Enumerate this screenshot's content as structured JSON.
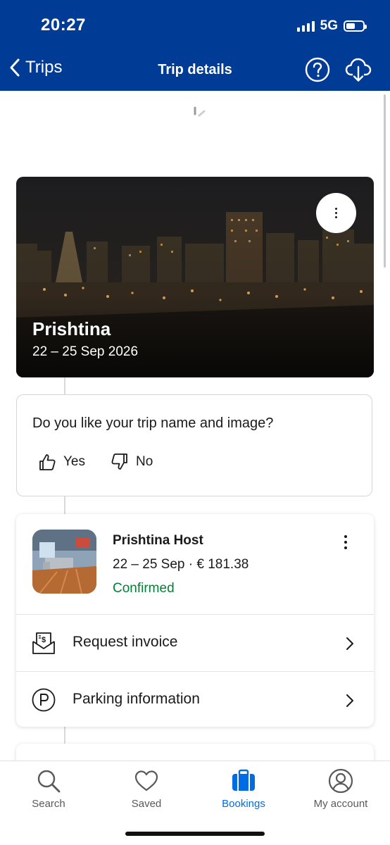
{
  "status_bar": {
    "time": "20:27",
    "network": "5G",
    "battery_level": 0.55
  },
  "header": {
    "back_label": "Trips",
    "title": "Trip details",
    "help_icon": "question-circle-icon",
    "download_icon": "cloud-download-icon"
  },
  "trip": {
    "name": "Prishtina",
    "dates": "22 – 25 Sep 2026"
  },
  "feedback": {
    "question": "Do you like your trip name and image?",
    "yes_label": "Yes",
    "no_label": "No"
  },
  "booking": {
    "name": "Prishtina Host",
    "details": "22 – 25 Sep · € 181.38",
    "status": "Confirmed",
    "actions": [
      {
        "label": "Request invoice",
        "icon": "invoice-icon"
      },
      {
        "label": "Parking information",
        "icon": "parking-icon"
      }
    ]
  },
  "nav": {
    "items": [
      {
        "label": "Search",
        "icon": "search-icon"
      },
      {
        "label": "Saved",
        "icon": "heart-icon"
      },
      {
        "label": "Bookings",
        "icon": "suitcase-icon",
        "active": true
      },
      {
        "label": "My account",
        "icon": "account-icon"
      }
    ]
  },
  "colors": {
    "brand": "#003b95",
    "accent": "#006ce4",
    "confirmed": "#008234"
  }
}
